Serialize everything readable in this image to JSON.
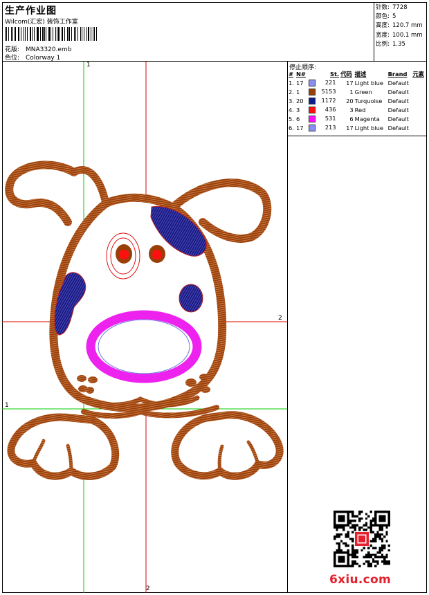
{
  "header": {
    "title": "生产作业图",
    "company": "Wilcom(汇宏) 装饰工作室",
    "design_label": "花版:",
    "design_value": "MNA3320.emb",
    "color_label": "色位:",
    "color_value": "Colorway 1"
  },
  "stats": {
    "stitches_label": "针数:",
    "stitches": "7728",
    "colors_label": "颜色:",
    "colors": "5",
    "height_label": "高度:",
    "height": "120.7 mm",
    "width_label": "宽度:",
    "width": "100.1 mm",
    "scale_label": "比例:",
    "scale": "1.35"
  },
  "sequence": {
    "title": "停止顺序:",
    "headers": [
      "#",
      "N#",
      "St.",
      "代码",
      "描述",
      "Brand",
      "元素"
    ],
    "rows": [
      {
        "idx": "1.",
        "n": "17",
        "color": "#8a8ef0",
        "st": "221",
        "code": "17",
        "desc": "Light blue",
        "brand": "Default"
      },
      {
        "idx": "2.",
        "n": "1",
        "color": "#9a3f0a",
        "st": "5153",
        "code": "1",
        "desc": "Green",
        "brand": "Default"
      },
      {
        "idx": "3.",
        "n": "20",
        "color": "#0c1e8a",
        "st": "1172",
        "code": "20",
        "desc": "Turquoise",
        "brand": "Default"
      },
      {
        "idx": "4.",
        "n": "3",
        "color": "#ff1010",
        "st": "436",
        "code": "3",
        "desc": "Red",
        "brand": "Default"
      },
      {
        "idx": "5.",
        "n": "6",
        "color": "#ff10ff",
        "st": "531",
        "code": "6",
        "desc": "Magenta",
        "brand": "Default"
      },
      {
        "idx": "6.",
        "n": "17",
        "color": "#8a8ef0",
        "st": "213",
        "code": "17",
        "desc": "Light blue",
        "brand": "Default"
      }
    ]
  },
  "markers": {
    "top_v": "1",
    "right_h": "2",
    "left_h": "1",
    "bottom_v": "2"
  },
  "watermark": "6xiu.com",
  "colors": {
    "brown": "#9a3f0a",
    "navy": "#1a1a7a",
    "red": "#e01010",
    "magenta": "#ee22ee",
    "lightblue": "#7070e0",
    "guide_green": "#00cc00",
    "guide_red": "#dd0000"
  }
}
